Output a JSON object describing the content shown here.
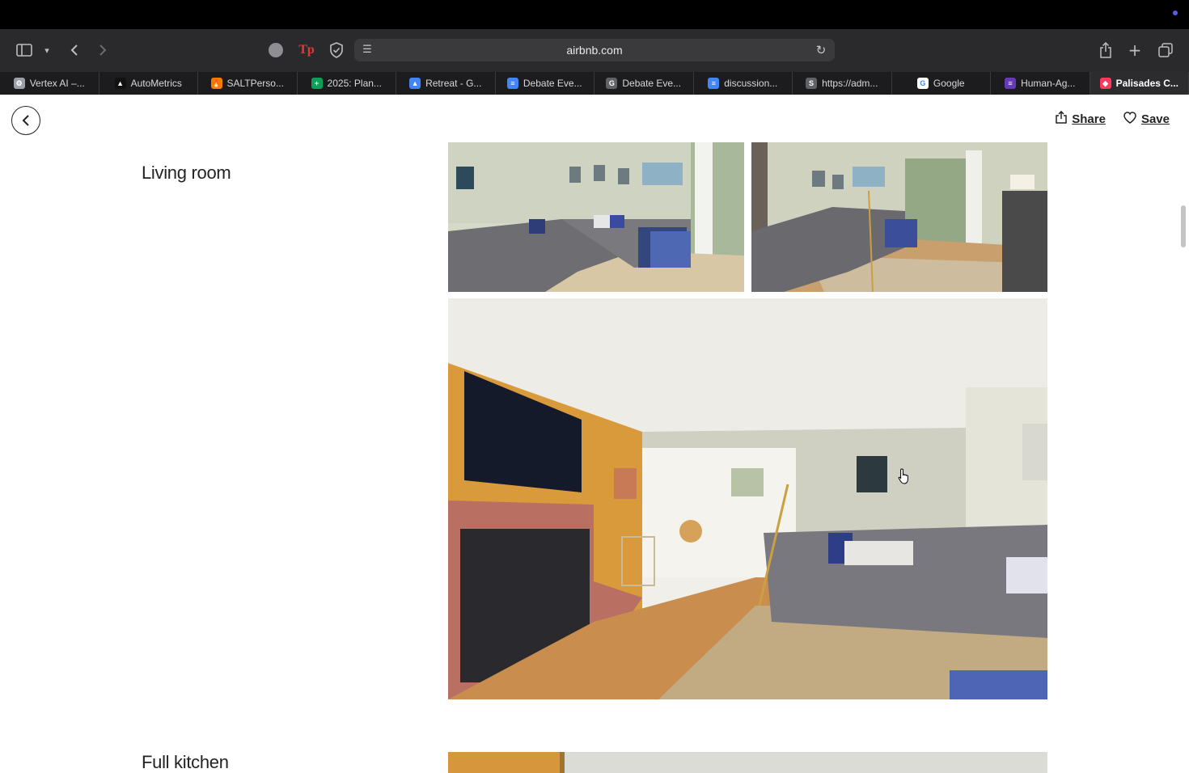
{
  "browser": {
    "url": "airbnb.com",
    "tabs": [
      {
        "label": "Vertex AI –...",
        "icon_color": "#9aa0a6",
        "icon_glyph": "⚙"
      },
      {
        "label": "AutoMetrics",
        "icon_color": "#111111",
        "icon_glyph": "▲"
      },
      {
        "label": "SALTPerso...",
        "icon_color": "#f57c00",
        "icon_glyph": "🔥"
      },
      {
        "label": "2025: Plan...",
        "icon_color": "#0f9d58",
        "icon_glyph": "+"
      },
      {
        "label": "Retreat - G...",
        "icon_color": "#4285f4",
        "icon_glyph": "▲"
      },
      {
        "label": "Debate Eve...",
        "icon_color": "#4285f4",
        "icon_glyph": "≡"
      },
      {
        "label": "Debate Eve...",
        "icon_color": "#5f6368",
        "icon_glyph": "G"
      },
      {
        "label": "discussion...",
        "icon_color": "#4285f4",
        "icon_glyph": "≡"
      },
      {
        "label": "https://adm...",
        "icon_color": "#5f6368",
        "icon_glyph": "S"
      },
      {
        "label": "Google",
        "icon_color": "#ffffff",
        "icon_glyph": "G"
      },
      {
        "label": "Human-Ag...",
        "icon_color": "#673ab7",
        "icon_glyph": "≡"
      },
      {
        "label": "Palisades C...",
        "icon_color": "#ff385c",
        "icon_glyph": "◆"
      }
    ]
  },
  "header": {
    "share_label": "Share",
    "save_label": "Save"
  },
  "sections": [
    {
      "title": "Living room"
    },
    {
      "title": "Full kitchen"
    }
  ]
}
